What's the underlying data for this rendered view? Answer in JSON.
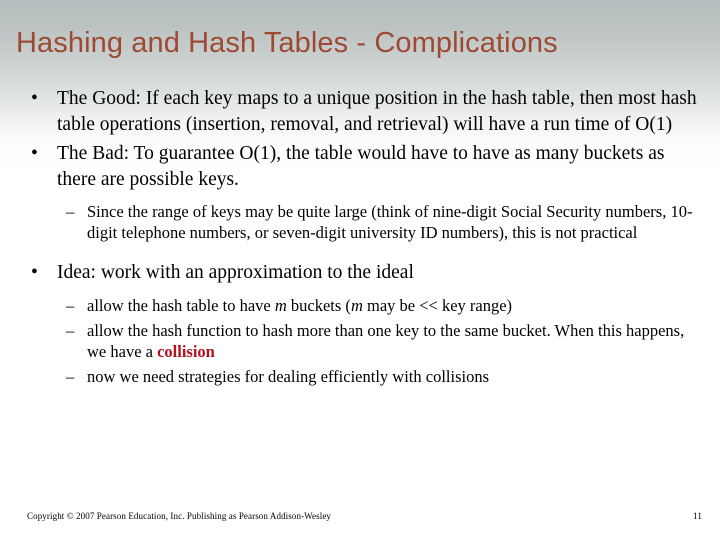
{
  "slide": {
    "title": "Hashing and Hash Tables - Complications",
    "title_color": "#9e4a33",
    "background_top_color": "#b3bcbc",
    "background_bottom_color": "#ffffff",
    "bullet_glyph": "•",
    "dash_glyph": "–",
    "content": {
      "bullet_good": {
        "part1": "The Good: If each key maps to a unique position in the hash table, then most hash table operations (insertion, removal, and retrieval) will have a run time of O(1)"
      },
      "bullet_bad": {
        "part1": "The Bad: To guarantee O(1), the table would have to have as many buckets as there are possible keys."
      },
      "sub_range": {
        "part1": "Since the range of keys may be quite large (think of nine-digit Social Security numbers, 10-digit telephone numbers, or seven-digit university ID numbers), this is not practical"
      },
      "bullet_idea": {
        "part1": "Idea: work with an approximation to the ideal"
      },
      "sub_m_buckets": {
        "part1": "allow the hash table to have ",
        "var1": "m",
        "part2": " buckets (",
        "var2": "m",
        "part3": " may be << key range)"
      },
      "sub_collision": {
        "part1": "allow the hash function to hash more than one key to the same bucket. When this happens, we have a ",
        "highlight": "collision",
        "highlight_color": "#b3121f"
      },
      "sub_strategies": {
        "part1": "now we need strategies for dealing efficiently with collisions"
      }
    }
  },
  "footer": {
    "copyright": "Copyright © 2007 Pearson Education, Inc. Publishing as Pearson Addison-Wesley",
    "page_number": "11"
  }
}
